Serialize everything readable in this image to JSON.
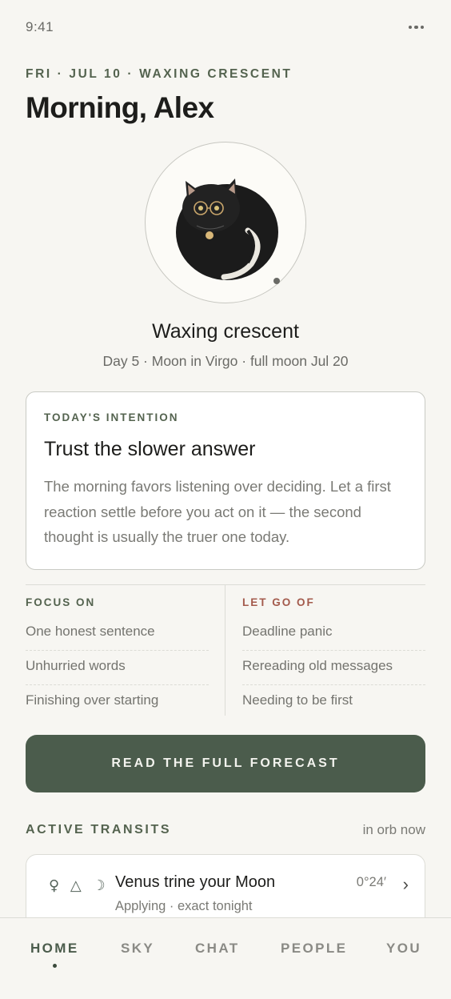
{
  "status": {
    "time": "9:41"
  },
  "header": {
    "date_line": "FRI · JUL 10 · WAXING CRESCENT",
    "greeting": "Morning, Alex"
  },
  "moon": {
    "phase_title": "Waxing crescent",
    "phase_sub": "Day 5 · Moon in Virgo · full moon Jul 20"
  },
  "intention": {
    "label": "TODAY'S INTENTION",
    "title": "Trust the slower answer",
    "body": "The morning favors listening over deciding. Let a first reaction settle before you act on it — the second thought is usually the truer one today."
  },
  "focus_on": {
    "label": "FOCUS ON",
    "items": [
      "One honest sentence",
      "Unhurried words",
      "Finishing over starting"
    ]
  },
  "let_go_of": {
    "label": "LET GO OF",
    "items": [
      "Deadline panic",
      "Rereading old messages",
      "Needing to be first"
    ]
  },
  "forecast_button": "READ THE FULL FORECAST",
  "transits": {
    "label": "ACTIVE TRANSITS",
    "orb_note": "in orb now",
    "items": [
      {
        "glyphs": "♀ △ ☽",
        "title": "Venus trine your Moon",
        "subtitle": "Applying · exact tonight",
        "degree": "0°24′"
      }
    ]
  },
  "tabs": [
    {
      "label": "HOME",
      "active": true
    },
    {
      "label": "SKY",
      "active": false
    },
    {
      "label": "CHAT",
      "active": false
    },
    {
      "label": "PEOPLE",
      "active": false
    },
    {
      "label": "YOU",
      "active": false
    }
  ],
  "colors": {
    "background": "#f7f6f2",
    "accent_green": "#4b5c4c",
    "label_green": "#54634f",
    "label_red": "#a35a4c"
  }
}
